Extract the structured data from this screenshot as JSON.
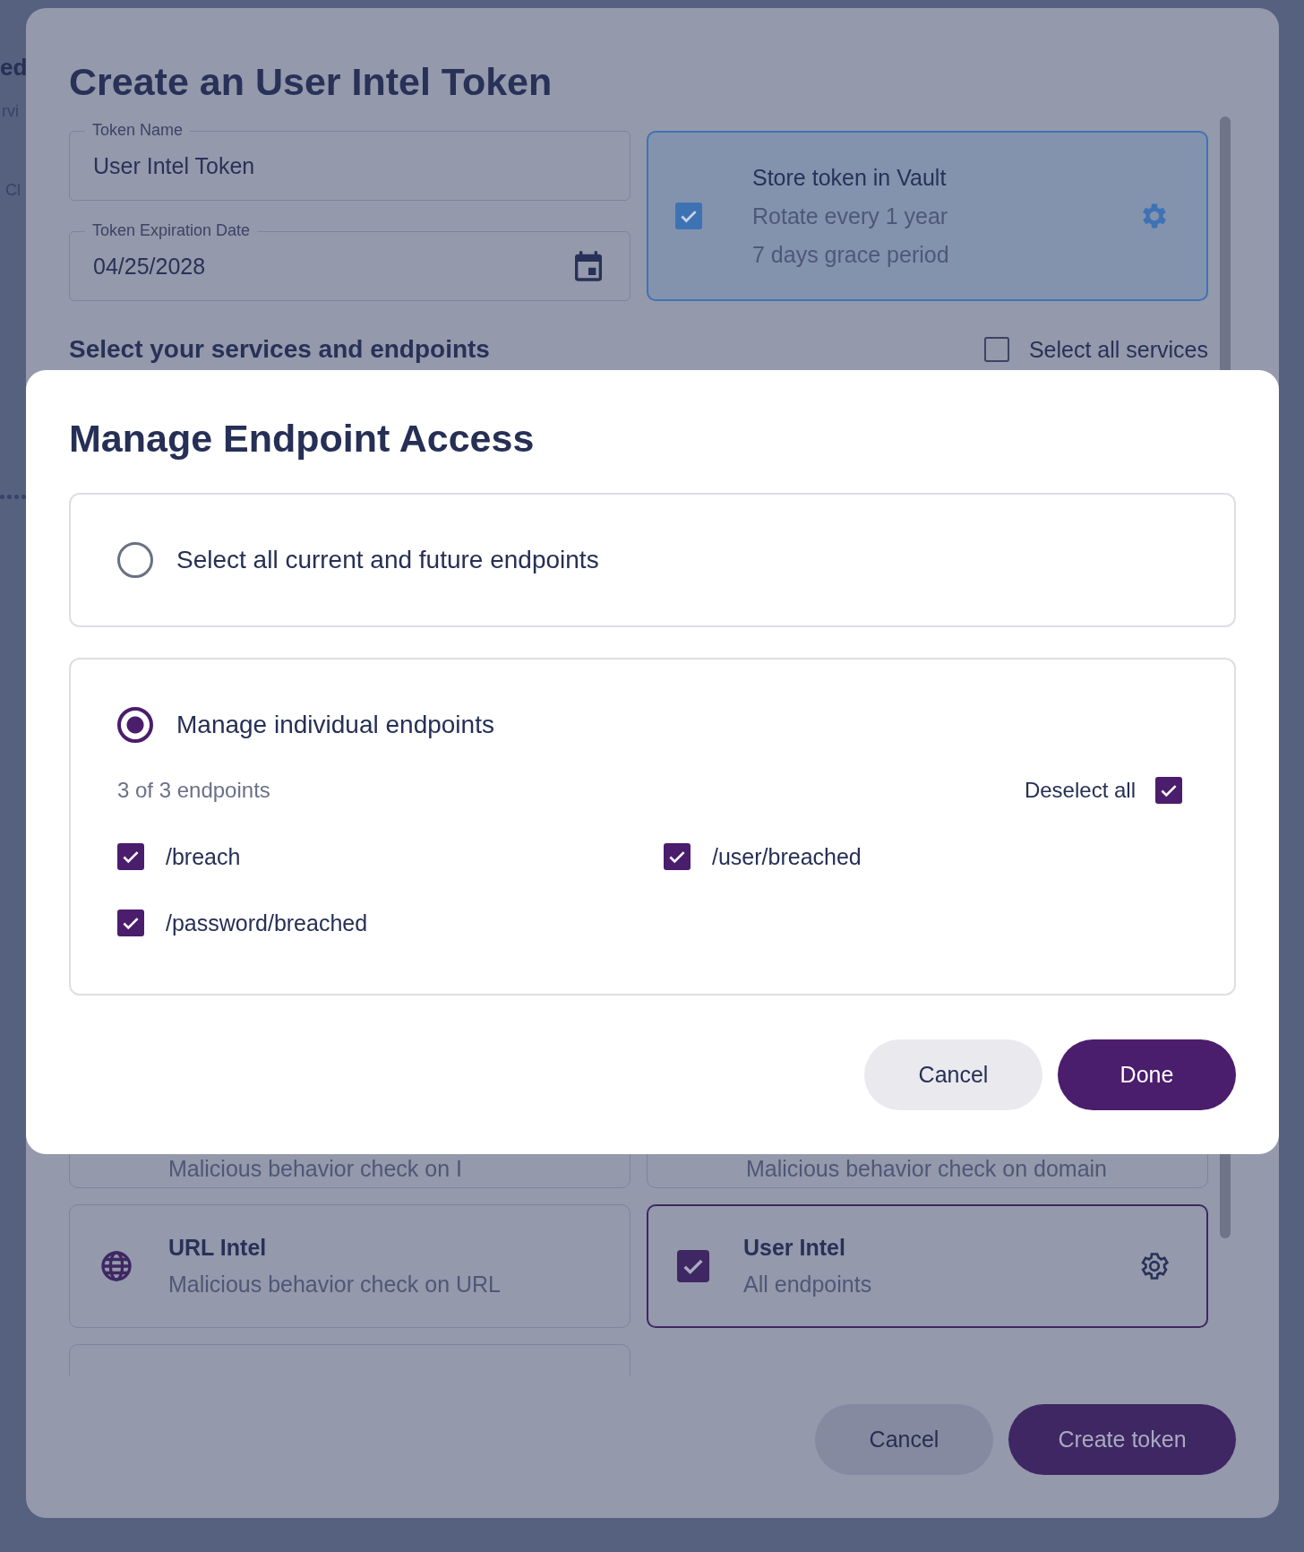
{
  "background_page": {
    "fragments": [
      {
        "text": "ed",
        "kind": "heading"
      },
      {
        "text": "rvi",
        "kind": "subtitle"
      },
      {
        "text": "Cl",
        "kind": "tab"
      }
    ]
  },
  "dialog": {
    "title": "Create an User Intel Token",
    "fields": [
      {
        "label": "Token Name",
        "value": "User Intel Token",
        "kind": "text"
      },
      {
        "label": "Token Expiration Date",
        "value": "04/25/2028",
        "kind": "date"
      }
    ],
    "vault": {
      "checked": true,
      "title": "Store token in Vault",
      "lines": [
        "Rotate every 1 year",
        "7 days grace period"
      ]
    },
    "services_heading": "Select your services and endpoints",
    "select_all_services": {
      "label": "Select all services",
      "checked": false
    },
    "services": [
      {
        "kind": "partial",
        "description": "Malicious behavior check on I"
      },
      {
        "kind": "partial",
        "description": "Malicious behavior check on domain"
      },
      {
        "kind": "icon",
        "name": "URL Intel",
        "description": "Malicious behavior check on URL"
      },
      {
        "kind": "checkbox",
        "checked": true,
        "name": "User Intel",
        "description": "All endpoints"
      },
      {
        "kind": "empty"
      }
    ],
    "buttons": [
      {
        "label": "Cancel",
        "kind": "secondary"
      },
      {
        "label": "Create token",
        "kind": "primary"
      }
    ]
  },
  "modal": {
    "title": "Manage Endpoint Access",
    "options": [
      {
        "label": "Select all current and future endpoints",
        "selected": false
      },
      {
        "label": "Manage individual endpoints",
        "selected": true
      }
    ],
    "count": "3 of 3 endpoints",
    "deselect_all": {
      "label": "Deselect all",
      "checked": true
    },
    "endpoints": [
      {
        "path": "/breach",
        "checked": true
      },
      {
        "path": "/user/breached",
        "checked": true
      },
      {
        "path": "/password/breached",
        "checked": true
      }
    ],
    "buttons": [
      {
        "label": "Cancel",
        "kind": "secondary"
      },
      {
        "label": "Done",
        "kind": "primary"
      }
    ]
  }
}
